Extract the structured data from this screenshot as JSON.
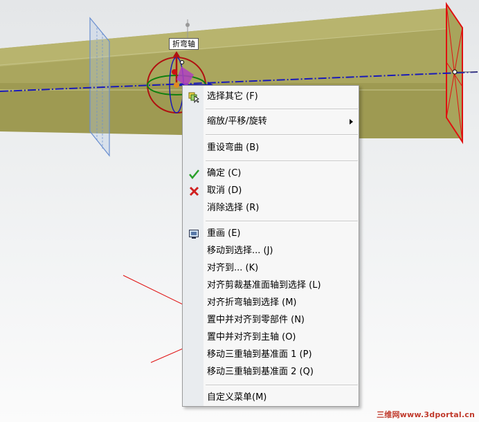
{
  "viewport": {
    "tooltip_label": "折弯轴",
    "accent_colors": {
      "beam": "#a8a45c",
      "axis_red": "#d81818",
      "axis_blue": "#1a1ab8",
      "axis_green": "#108010"
    }
  },
  "context_menu": {
    "items": [
      {
        "label": "选择其它 (F)",
        "icon": "select-other-icon"
      },
      {
        "label": "缩放/平移/旋转",
        "icon": "",
        "submenu": true
      },
      {
        "label": "重设弯曲 (B)",
        "icon": ""
      },
      {
        "label": "确定 (C)",
        "icon": "checkmark-icon"
      },
      {
        "label": "取消 (D)",
        "icon": "cancel-x-icon"
      },
      {
        "label": "消除选择 (R)",
        "icon": ""
      },
      {
        "label": "重画 (E)",
        "icon": "redraw-icon"
      },
      {
        "label": "移动到选择... (J)",
        "icon": ""
      },
      {
        "label": "对齐到... (K)",
        "icon": ""
      },
      {
        "label": "对齐剪裁基准面轴到选择 (L)",
        "icon": ""
      },
      {
        "label": "对齐折弯轴到选择 (M)",
        "icon": ""
      },
      {
        "label": "置中并对齐到零部件 (N)",
        "icon": ""
      },
      {
        "label": "置中并对齐到主轴 (O)",
        "icon": ""
      },
      {
        "label": "移动三重轴到基准面 1 (P)",
        "icon": ""
      },
      {
        "label": "移动三重轴到基准面 2 (Q)",
        "icon": ""
      },
      {
        "label": "自定义菜单(M)",
        "icon": ""
      }
    ]
  },
  "watermark": {
    "text": "三维网www.3dportal.cn"
  }
}
